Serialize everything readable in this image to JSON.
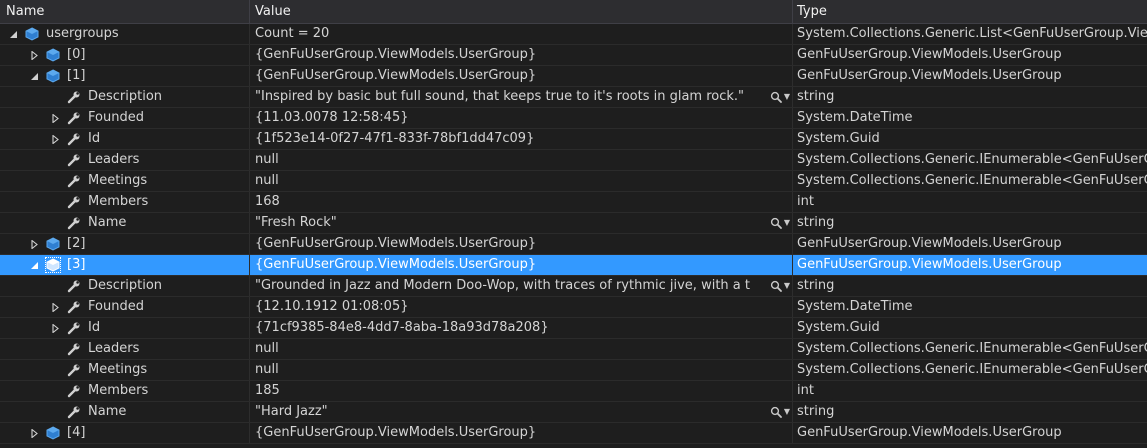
{
  "header": {
    "name": "Name",
    "value": "Value",
    "type": "Type"
  },
  "rows": [
    {
      "depth": 0,
      "expander": "expanded",
      "icon": "object-icon",
      "name": "usergroups",
      "value": "Count = 20",
      "type": "System.Collections.Generic.List<GenFuUserGroup.ViewModels.UserGroup>",
      "mag": false
    },
    {
      "depth": 1,
      "expander": "collapsed",
      "icon": "object-icon",
      "name": "[0]",
      "value": "{GenFuUserGroup.ViewModels.UserGroup}",
      "type": "GenFuUserGroup.ViewModels.UserGroup",
      "mag": false
    },
    {
      "depth": 1,
      "expander": "expanded",
      "icon": "object-icon",
      "name": "[1]",
      "value": "{GenFuUserGroup.ViewModels.UserGroup}",
      "type": "GenFuUserGroup.ViewModels.UserGroup",
      "mag": false
    },
    {
      "depth": 2,
      "expander": "none",
      "icon": "wrench-icon",
      "name": "Description",
      "value": "\"Inspired by basic but full sound, that keeps true to it's roots in glam rock.\"",
      "type": "string",
      "mag": true
    },
    {
      "depth": 2,
      "expander": "collapsed",
      "icon": "wrench-icon",
      "name": "Founded",
      "value": "{11.03.0078 12:58:45}",
      "type": "System.DateTime",
      "mag": false
    },
    {
      "depth": 2,
      "expander": "collapsed",
      "icon": "wrench-icon",
      "name": "Id",
      "value": "{1f523e14-0f27-47f1-833f-78bf1dd47c09}",
      "type": "System.Guid",
      "mag": false
    },
    {
      "depth": 2,
      "expander": "none",
      "icon": "wrench-icon",
      "name": "Leaders",
      "value": "null",
      "type": "System.Collections.Generic.IEnumerable<GenFuUserGroup.ViewModels.Leader>",
      "mag": false
    },
    {
      "depth": 2,
      "expander": "none",
      "icon": "wrench-icon",
      "name": "Meetings",
      "value": "null",
      "type": "System.Collections.Generic.IEnumerable<GenFuUserGroup.ViewModels.Meeting>",
      "mag": false
    },
    {
      "depth": 2,
      "expander": "none",
      "icon": "wrench-icon",
      "name": "Members",
      "value": "168",
      "type": "int",
      "mag": false
    },
    {
      "depth": 2,
      "expander": "none",
      "icon": "wrench-icon",
      "name": "Name",
      "value": "\"Fresh Rock\"",
      "type": "string",
      "mag": true
    },
    {
      "depth": 1,
      "expander": "collapsed",
      "icon": "object-icon",
      "name": "[2]",
      "value": "{GenFuUserGroup.ViewModels.UserGroup}",
      "type": "GenFuUserGroup.ViewModels.UserGroup",
      "mag": false
    },
    {
      "depth": 1,
      "expander": "expanded",
      "icon": "object-icon",
      "name": "[3]",
      "value": "{GenFuUserGroup.ViewModels.UserGroup}",
      "type": "GenFuUserGroup.ViewModels.UserGroup",
      "mag": false,
      "selected": true
    },
    {
      "depth": 2,
      "expander": "none",
      "icon": "wrench-icon",
      "name": "Description",
      "value": "\"Grounded in Jazz and Modern Doo-Wop, with traces of rythmic jive, with a t",
      "type": "string",
      "mag": true
    },
    {
      "depth": 2,
      "expander": "collapsed",
      "icon": "wrench-icon",
      "name": "Founded",
      "value": "{12.10.1912 01:08:05}",
      "type": "System.DateTime",
      "mag": false
    },
    {
      "depth": 2,
      "expander": "collapsed",
      "icon": "wrench-icon",
      "name": "Id",
      "value": "{71cf9385-84e8-4dd7-8aba-18a93d78a208}",
      "type": "System.Guid",
      "mag": false
    },
    {
      "depth": 2,
      "expander": "none",
      "icon": "wrench-icon",
      "name": "Leaders",
      "value": "null",
      "type": "System.Collections.Generic.IEnumerable<GenFuUserGroup.ViewModels.Leader>",
      "mag": false
    },
    {
      "depth": 2,
      "expander": "none",
      "icon": "wrench-icon",
      "name": "Meetings",
      "value": "null",
      "type": "System.Collections.Generic.IEnumerable<GenFuUserGroup.ViewModels.Meeting>",
      "mag": false
    },
    {
      "depth": 2,
      "expander": "none",
      "icon": "wrench-icon",
      "name": "Members",
      "value": "185",
      "type": "int",
      "mag": false
    },
    {
      "depth": 2,
      "expander": "none",
      "icon": "wrench-icon",
      "name": "Name",
      "value": "\"Hard Jazz\"",
      "type": "string",
      "mag": true
    },
    {
      "depth": 1,
      "expander": "collapsed",
      "icon": "object-icon",
      "name": "[4]",
      "value": "{GenFuUserGroup.ViewModels.UserGroup}",
      "type": "GenFuUserGroup.ViewModels.UserGroup",
      "mag": false
    }
  ],
  "colors": {
    "background": "#1e1e1e",
    "header": "#2d2d30",
    "selected": "#3399ff",
    "object_icon": "#4e9de8",
    "text": "#d4d4d4"
  }
}
